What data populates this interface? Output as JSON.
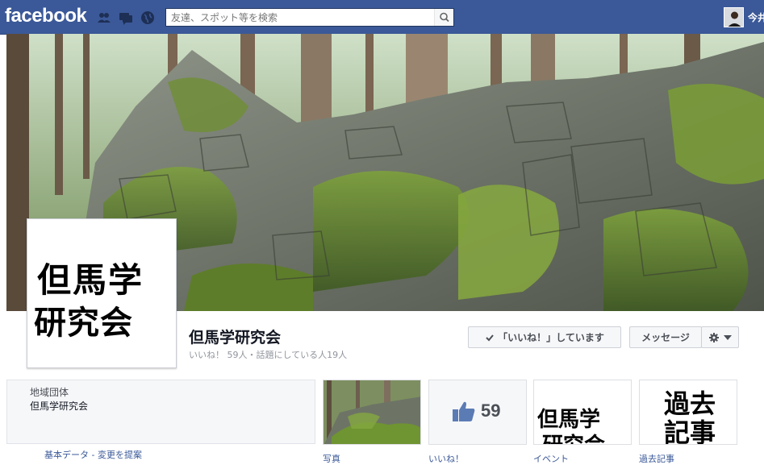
{
  "header": {
    "logo": "facebook",
    "search_placeholder": "友達、スポット等を検索",
    "username": "今井"
  },
  "page": {
    "name": "但馬学研究会",
    "stats": "いいね！ 59人・話題にしている人19人",
    "profile_line1": "但馬学",
    "profile_line2": "研究会"
  },
  "actions": {
    "like_label": "「いいね！」しています",
    "message_label": "メッセージ"
  },
  "about": {
    "category": "地域団体",
    "name": "但馬学研究会",
    "link": "基本データ - 変更を提案"
  },
  "tiles": {
    "photos_label": "写真",
    "likes_label": "いいね！",
    "likes_count": "59",
    "events_label": "イベント",
    "events_line1": "但馬学",
    "events_line2": "研究会",
    "past_label": "過去記事",
    "past_line1": "過去",
    "past_line2": "記事"
  },
  "colors": {
    "brand": "#3b5998",
    "text": "#141823",
    "muted": "#90949c"
  }
}
